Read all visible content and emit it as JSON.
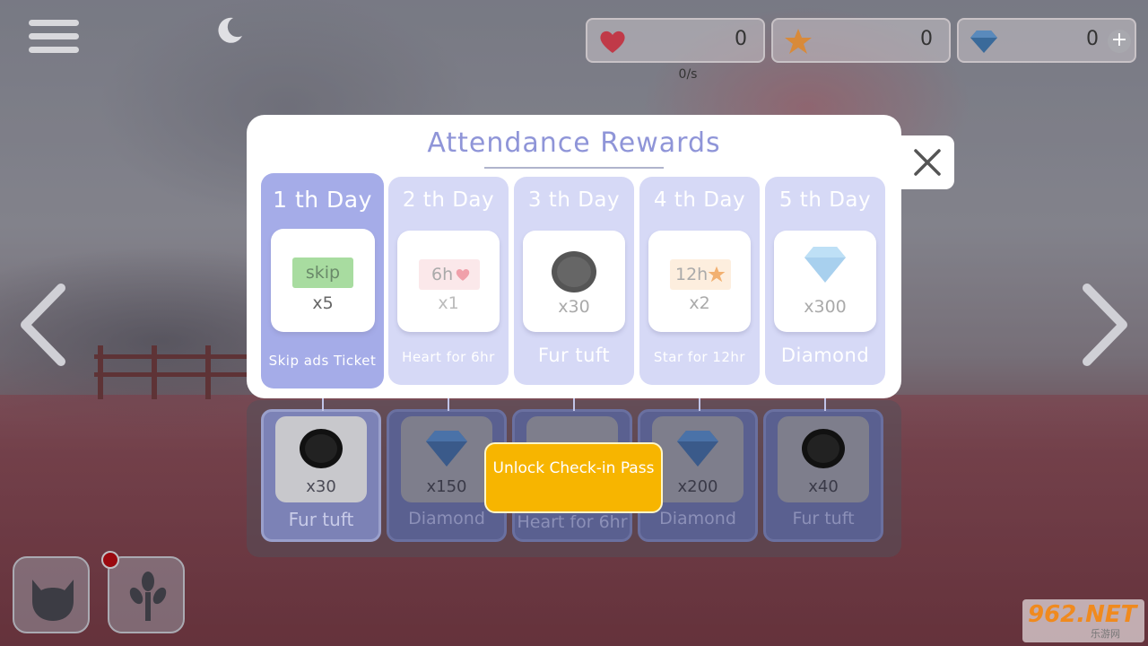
{
  "hud": {
    "hearts": "0",
    "stars": "0",
    "diamonds": "0",
    "rate": "0/s",
    "plus_label": "+"
  },
  "modal": {
    "title": "Attendance Rewards",
    "free_days": [
      {
        "day": "1 th Day",
        "qty": "x5",
        "name": "Skip ads Ticket",
        "icon": "skip-ticket-icon",
        "ticket_text": "skip"
      },
      {
        "day": "2 th Day",
        "qty": "x1",
        "name": "Heart for 6hr",
        "icon": "heart-ticket-icon",
        "ticket_text": "6h"
      },
      {
        "day": "3 th Day",
        "qty": "x30",
        "name": "Fur tuft",
        "icon": "fur-tuft-icon"
      },
      {
        "day": "4 th Day",
        "qty": "x2",
        "name": "Star for 12hr",
        "icon": "star-ticket-icon",
        "ticket_text": "12h"
      },
      {
        "day": "5 th Day",
        "qty": "x300",
        "name": "Diamond",
        "icon": "diamond-icon"
      }
    ],
    "premium_days": [
      {
        "qty": "x30",
        "name": "Fur tuft",
        "icon": "fur-tuft-icon"
      },
      {
        "qty": "x150",
        "name": "Diamond",
        "icon": "diamond-icon"
      },
      {
        "qty": "",
        "name": "Heart for 6hr",
        "icon": "heart-ticket-icon"
      },
      {
        "qty": "x200",
        "name": "Diamond",
        "icon": "diamond-icon"
      },
      {
        "qty": "x40",
        "name": "Fur tuft",
        "icon": "fur-tuft-icon"
      }
    ],
    "unlock_button": "Unlock Check-in Pass"
  },
  "watermark": {
    "brand": "962.NET",
    "sub": "乐游网"
  },
  "colors": {
    "accent": "#8f95d8",
    "card_active": "#a5ace8",
    "card": "#d6d9f6",
    "unlock": "#f7b500",
    "heart": "#c03a48",
    "star": "#d88a3a",
    "diamond": "#3a6a9a"
  }
}
